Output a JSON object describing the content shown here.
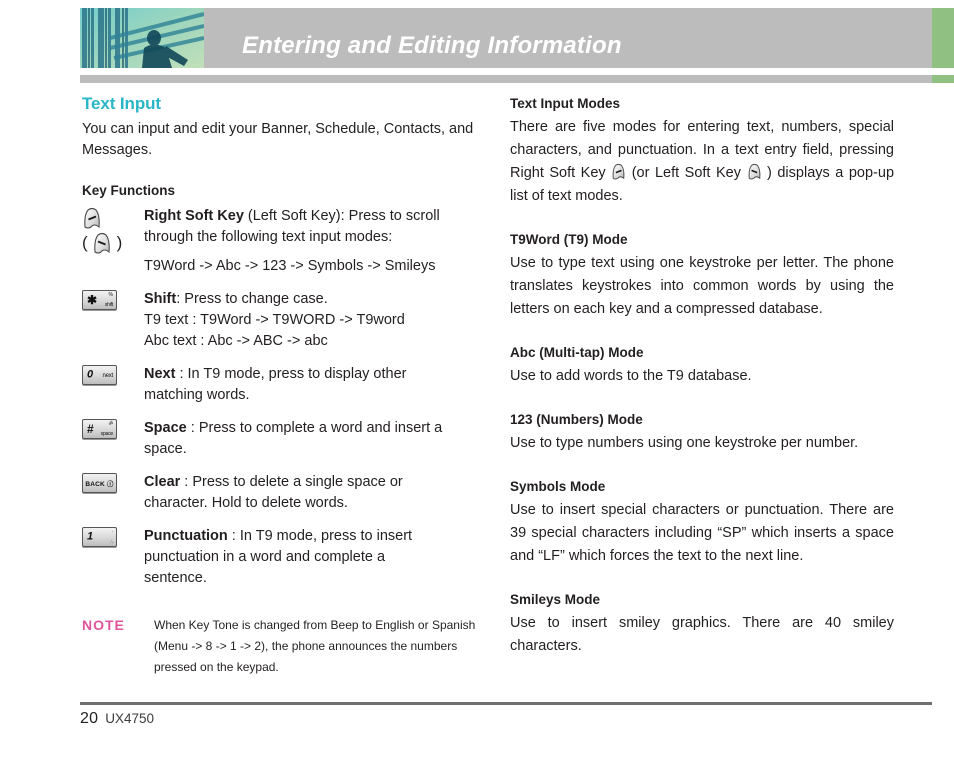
{
  "header": {
    "title": "Entering and Editing Information",
    "bar_color": "#bcbcbc",
    "accent_color": "#90c183",
    "photo_alt": "teal-architecture-photo"
  },
  "left_column": {
    "section_title": "Text Input",
    "section_title_color": "#29b6c8",
    "intro": "You can input and edit your Banner, Schedule, Contacts, and Messages.",
    "key_functions_title": "Key Functions",
    "key_rows": [
      {
        "icon": "soft-key-glyph-pair",
        "icon_kind": "softkey",
        "lines": [
          {
            "bold": "Right Soft Key",
            "rest": " (Left Soft Key): Press to scroll"
          },
          {
            "bold": "",
            "rest": "through the following text input modes:"
          },
          {
            "bold": "",
            "rest": "T9Word -> Abc -> 123 -> Symbols -> Smileys"
          }
        ]
      },
      {
        "icon": "star-shift-key",
        "icon_kind": "chip",
        "chip": {
          "big": "✱",
          "sm_top": "%",
          "sm_bot": "shift",
          "style": "sym"
        },
        "lines": [
          {
            "bold": "Shift",
            "rest": ": Press to change case."
          },
          {
            "bold": "",
            "rest": "T9 text : T9Word -> T9WORD -> T9word"
          },
          {
            "bold": "",
            "rest": "Abc text : Abc -> ABC -> abc"
          }
        ]
      },
      {
        "icon": "zero-next-key",
        "icon_kind": "chip",
        "chip": {
          "big": "0",
          "sm_top": "",
          "sm_bot": "next",
          "style": "num"
        },
        "lines": [
          {
            "bold": "Next",
            "rest": " : In T9 mode, press to display other"
          },
          {
            "bold": "",
            "rest": "matching words."
          }
        ]
      },
      {
        "icon": "pound-space-key",
        "icon_kind": "chip",
        "chip": {
          "big": "#",
          "sm_top": "ॐ",
          "sm_bot": "space",
          "style": "sym"
        },
        "lines": [
          {
            "bold": "Space",
            "rest": " : Press to complete a word and insert a"
          },
          {
            "bold": "",
            "rest": "space."
          }
        ]
      },
      {
        "icon": "back-clear-key",
        "icon_kind": "chip-wide",
        "chip": {
          "center": "BACK ⓘ"
        },
        "lines": [
          {
            "bold": "Clear",
            "rest": " : Press to delete a single space or"
          },
          {
            "bold": "",
            "rest": "character. Hold to delete words."
          }
        ]
      },
      {
        "icon": "one-punctuation-key",
        "icon_kind": "chip",
        "chip": {
          "big": "1",
          "sm_top": "·",
          "sm_bot": "∴",
          "style": "num"
        },
        "lines": [
          {
            "bold": "Punctuation",
            "rest": " : In T9 mode, press to insert"
          },
          {
            "bold": "",
            "rest": "punctuation in a word and complete a"
          },
          {
            "bold": "",
            "rest": "sentence."
          }
        ]
      }
    ],
    "note": {
      "label": "NOTE",
      "label_color": "#e0549b",
      "body": "When Key Tone is changed from Beep to English or Spanish (Menu -> 8 -> 1 -> 2), the phone announces the numbers pressed on the keypad."
    }
  },
  "right_column": {
    "blocks": [
      {
        "heading": "Text Input Modes",
        "body_pre": "There are five modes for entering text, numbers, special characters, and punctuation. In a text entry field, pressing Right Soft Key ",
        "body_mid": " (or Left Soft Key ",
        "body_post": " ) displays a pop-up list of text modes.",
        "has_inline_icons": true
      },
      {
        "heading": "T9Word (T9) Mode",
        "body": "Use to type text using one keystroke per letter. The phone translates keystrokes into common words by using the letters on each key and a compressed database."
      },
      {
        "heading": "Abc (Multi-tap) Mode",
        "body": "Use to add words to the T9 database."
      },
      {
        "heading": "123 (Numbers) Mode",
        "body": "Use to type numbers using one keystroke per number."
      },
      {
        "heading": "Symbols Mode",
        "body": "Use to insert special characters or punctuation. There are 39 special characters including “SP” which inserts a space and “LF” which forces the text to the next line."
      },
      {
        "heading": "Smileys Mode",
        "body": "Use to insert smiley graphics. There are 40 smiley characters."
      }
    ]
  },
  "footer": {
    "page_number": "20",
    "model": "UX4750"
  }
}
